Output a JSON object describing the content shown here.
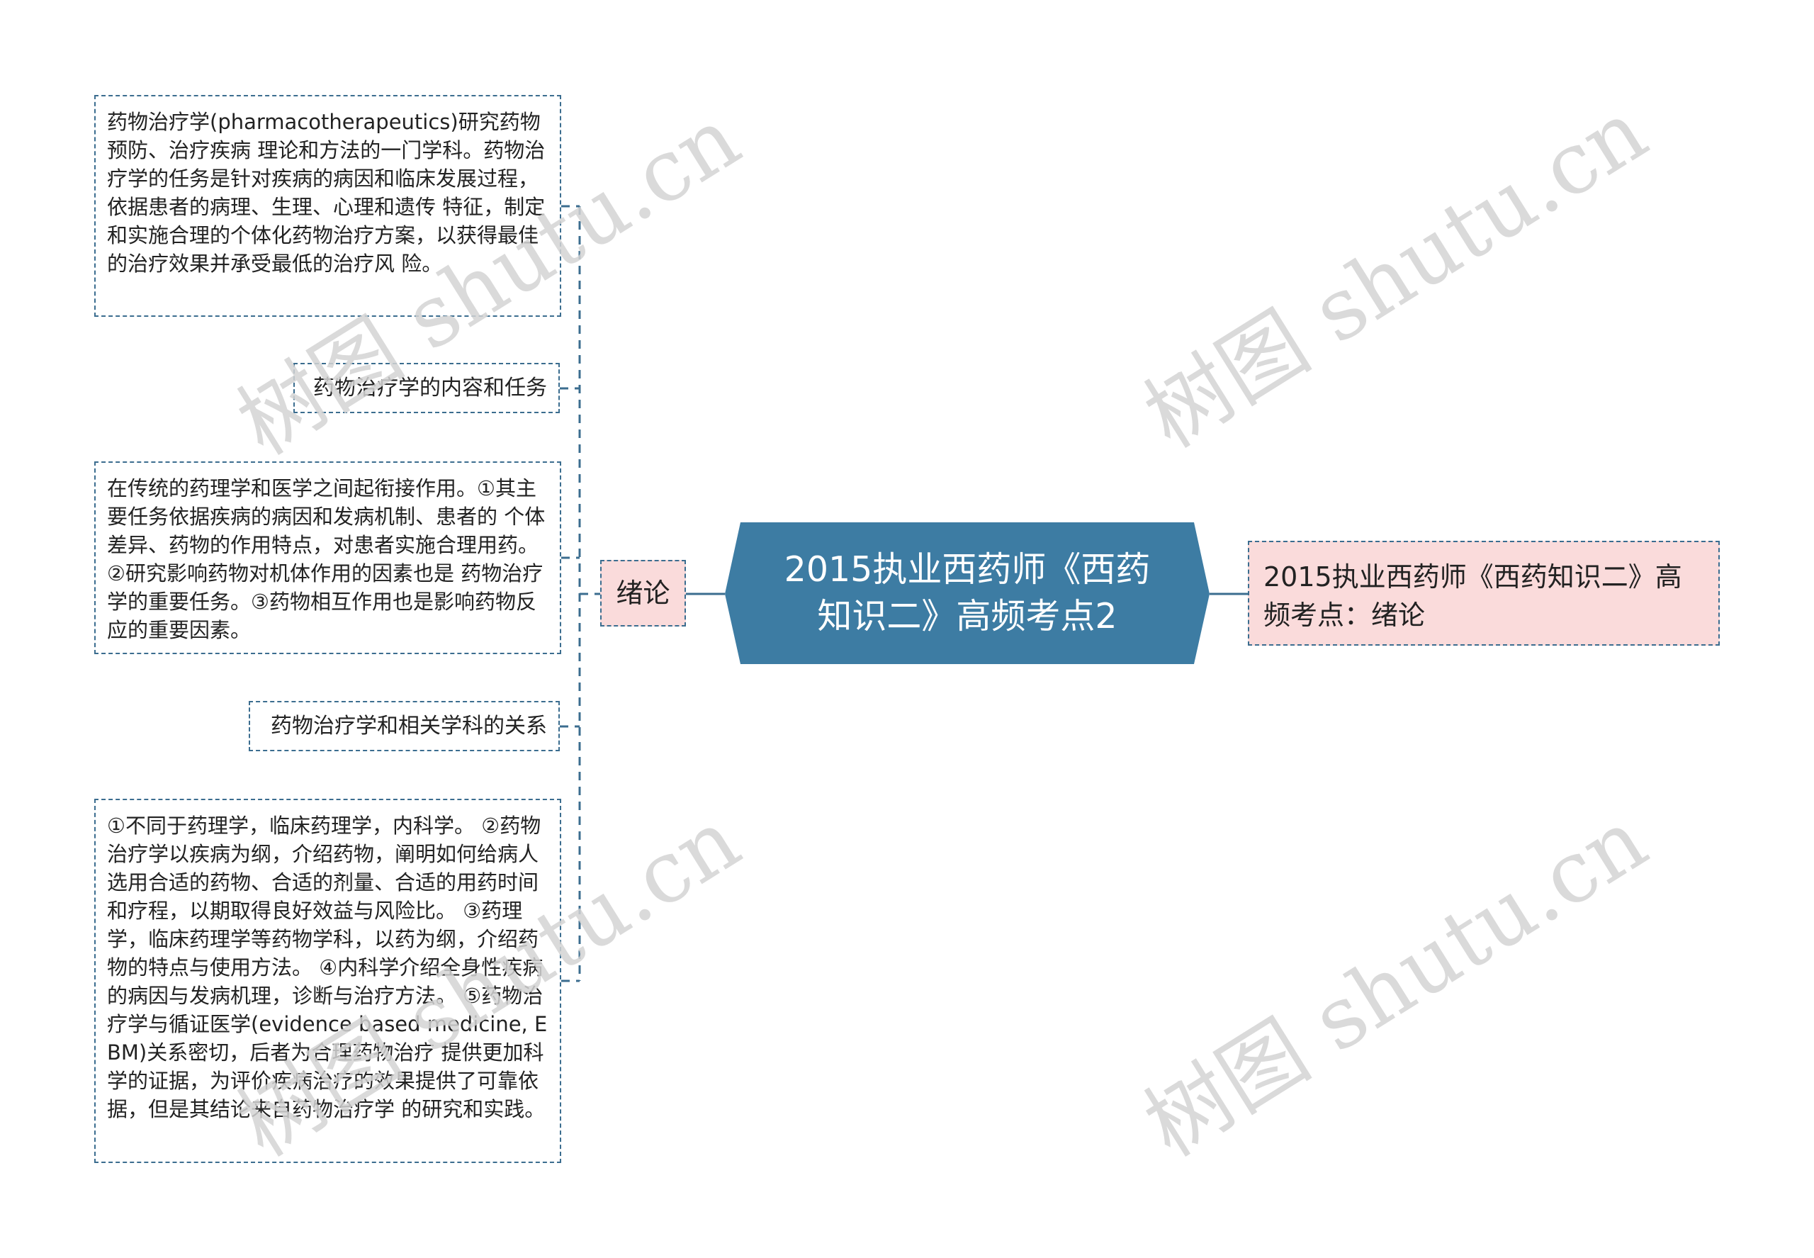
{
  "center": {
    "title": "2015执业西药师《西药知识二》高频考点2"
  },
  "right_node": {
    "text": "2015执业西药师《西药知识二》高频考点：绪论"
  },
  "branch": {
    "label": "绪论"
  },
  "children": [
    {
      "type": "detail",
      "text": "药物治疗学(pharmacotherapeutics)研究药物预防、治疗疾病 理论和方法的一门学科。药物治疗学的任务是针对疾病的病因和临床发展过程，依据患者的病理、生理、心理和遗传 特征，制定和实施合理的个体化药物治疗方案，以获得最佳的治疗效果并承受最低的治疗风 险。"
    },
    {
      "type": "topic",
      "text": "药物治疗学的内容和任务"
    },
    {
      "type": "detail",
      "text": "在传统的药理学和医学之间起衔接作用。①其主要任务依据疾病的病因和发病机制、患者的 个体差异、药物的作用特点，对患者实施合理用药。②研究影响药物对机体作用的因素也是 药物治疗学的重要任务。③药物相互作用也是影响药物反应的重要因素。"
    },
    {
      "type": "topic",
      "text": "药物治疗学和相关学科的关系"
    },
    {
      "type": "detail",
      "text": "①不同于药理学，临床药理学，内科学。 ②药物治疗学以疾病为纲，介绍药物，阐明如何给病人选用合适的药物、合适的剂量、合适的用药时间和疗程，以期取得良好效益与风险比。 ③药理学，临床药理学等药物学科，以药为纲，介绍药物的特点与使用方法。 ④内科学介绍全身性疾病的病因与发病机理，诊断与治疗方法。 ⑤药物治疗学与循证医学(evidence based medicine, EBM)关系密切，后者为合理药物治疗 提供更加科学的证据，为评价疾病治疗的效果提供了可靠依据，但是其结论来自药物治疗学 的研究和实践。"
    }
  ],
  "watermark": {
    "text": "树图 shutu.cn"
  },
  "colors": {
    "center_fill": "#3d7ca3",
    "border": "#3b6d8f",
    "pink": "#fadbdb",
    "watermark": "#d4d4d4"
  }
}
